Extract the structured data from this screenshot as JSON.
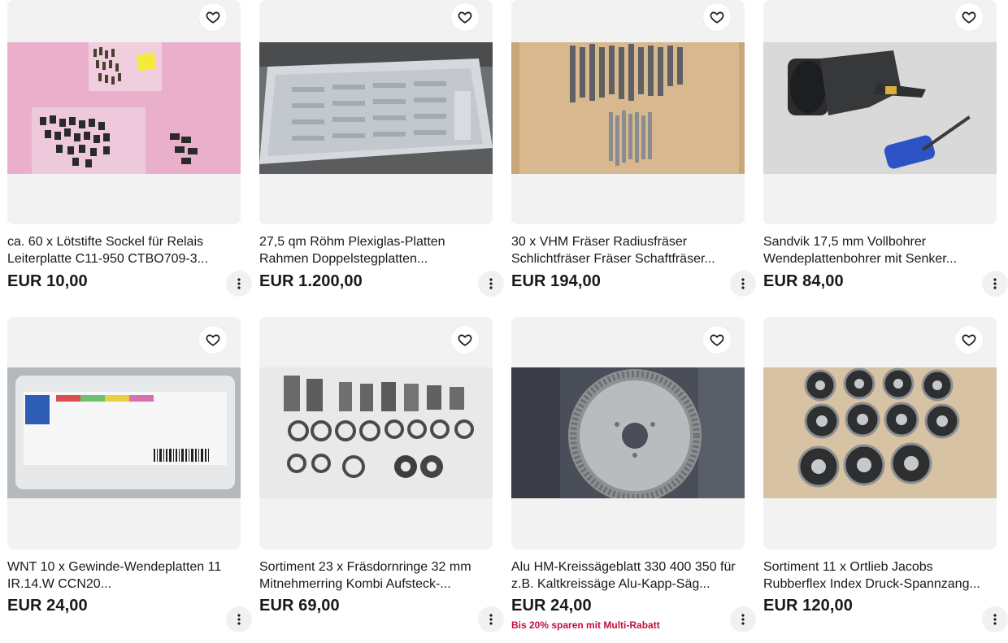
{
  "listings": [
    {
      "title": "ca. 60 x Lötstifte Sockel für Relais Leiterplatte C11-950 CTBO709-3...",
      "price": "EUR 10,00",
      "image": "relay-pins-photo",
      "favorite_icon": "heart-outline-icon",
      "more_icon": "vertical-ellipsis-icon"
    },
    {
      "title": "27,5 qm Röhm Plexiglas-Platten Rahmen Doppelstegplatten...",
      "price": "EUR 1.200,00",
      "image": "plexiglas-panels-photo",
      "favorite_icon": "heart-outline-icon",
      "more_icon": "vertical-ellipsis-icon"
    },
    {
      "title": "30 x VHM Fräser Radiusfräser Schlichtfräser Fräser Schaftfräser...",
      "price": "EUR 194,00",
      "image": "milling-cutters-photo",
      "favorite_icon": "heart-outline-icon",
      "more_icon": "vertical-ellipsis-icon"
    },
    {
      "title": "Sandvik 17,5 mm Vollbohrer Wendeplattenbohrer mit Senker...",
      "price": "EUR 84,00",
      "image": "sandvik-drill-photo",
      "favorite_icon": "heart-outline-icon",
      "more_icon": "vertical-ellipsis-icon"
    },
    {
      "title": "WNT 10 x Gewinde-Wendeplatten 11 IR.14.W CCN20...",
      "price": "EUR 24,00",
      "image": "wnt-inserts-box-photo",
      "favorite_icon": "heart-outline-icon",
      "more_icon": "vertical-ellipsis-icon"
    },
    {
      "title": "Sortiment 23 x Fräsdornringe 32 mm Mitnehmerring Kombi Aufsteck-...",
      "price": "EUR 69,00",
      "image": "arbor-rings-photo",
      "favorite_icon": "heart-outline-icon",
      "more_icon": "vertical-ellipsis-icon"
    },
    {
      "title": "Alu HM-Kreissägeblatt 330 400 350 für z.B. Kaltkreissäge Alu-Kapp-Säg...",
      "price": "EUR 24,00",
      "promo": "Bis 20% sparen mit Multi-Rabatt",
      "image": "saw-blade-photo",
      "favorite_icon": "heart-outline-icon",
      "more_icon": "vertical-ellipsis-icon"
    },
    {
      "title": "Sortiment 11 x Ortlieb Jacobs Rubberflex Index Druck-Spannzang...",
      "price": "EUR 120,00",
      "image": "rubberflex-collets-photo",
      "favorite_icon": "heart-outline-icon",
      "more_icon": "vertical-ellipsis-icon"
    }
  ],
  "colors": {
    "image_background": "#f2f2f2",
    "text": "#191919",
    "promo": "#c1103e",
    "icon_button_bg": "#f1f1f1"
  }
}
